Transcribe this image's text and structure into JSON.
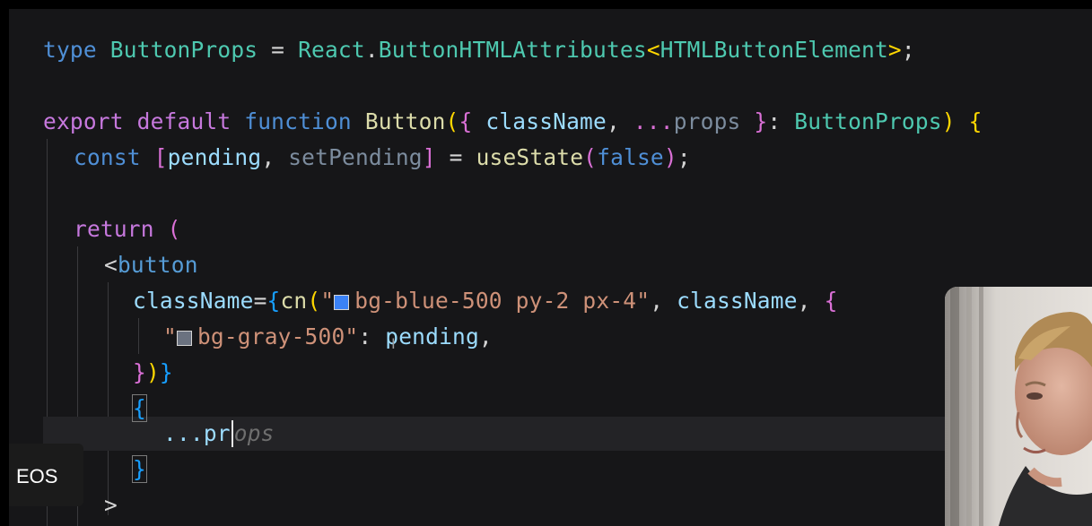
{
  "code": {
    "line1": {
      "type_kw": "type",
      "name": "ButtonProps",
      "eq": " = ",
      "react": "React",
      "dot": ".",
      "attrs": "ButtonHTMLAttributes",
      "lt": "<",
      "el": "HTMLButtonElement",
      "gt": ">",
      "semi": ";"
    },
    "line2": {
      "export_kw": "export",
      "default_kw": "default",
      "function_kw": "function",
      "fn_name": "Button",
      "paren_open": "(",
      "brace_open": "{",
      "param1": " className",
      "comma": ", ",
      "spread": "...",
      "param2": "props",
      "brace_close": " }",
      "colon": ": ",
      "type_ref": "ButtonProps",
      "paren_close": ")",
      "body_open": "{"
    },
    "line3": {
      "const_kw": "const",
      "bracket_open": "[",
      "var1": "pending",
      "comma": ", ",
      "var2": "setPending",
      "bracket_close": "]",
      "eq": " = ",
      "hook": "useState",
      "paren_open": "(",
      "val": "false",
      "paren_close": ")",
      "semi": ";"
    },
    "line4": {
      "return_kw": "return",
      "paren": "("
    },
    "line5": {
      "lt": "<",
      "tag": "button"
    },
    "line6": {
      "attr": "className",
      "eq": "=",
      "brace_open": "{",
      "fn": "cn",
      "paren_open": "(",
      "quote_open": "\"",
      "classes": "bg-blue-500 py-2 px-4",
      "quote_close": "\"",
      "comma1": ", ",
      "arg": "className",
      "comma2": ", ",
      "obj_open": "{"
    },
    "line7": {
      "quote_open": "\"",
      "key": "bg-gray-500",
      "quote_close": "\"",
      "colon": ": ",
      "val": "pending",
      "comma": ","
    },
    "line8": {
      "obj_close": "}",
      "paren_close": ")",
      "brace_close": "}"
    },
    "line9": {
      "brace": "{"
    },
    "line10": {
      "typed": "...pr",
      "ghost": "ops"
    },
    "line11": {
      "brace": "}"
    },
    "line12": {
      "gt": ">"
    }
  },
  "swatches": {
    "blue": "#3b82f6",
    "gray": "#6b7280"
  },
  "badge": {
    "label": "EOS"
  }
}
